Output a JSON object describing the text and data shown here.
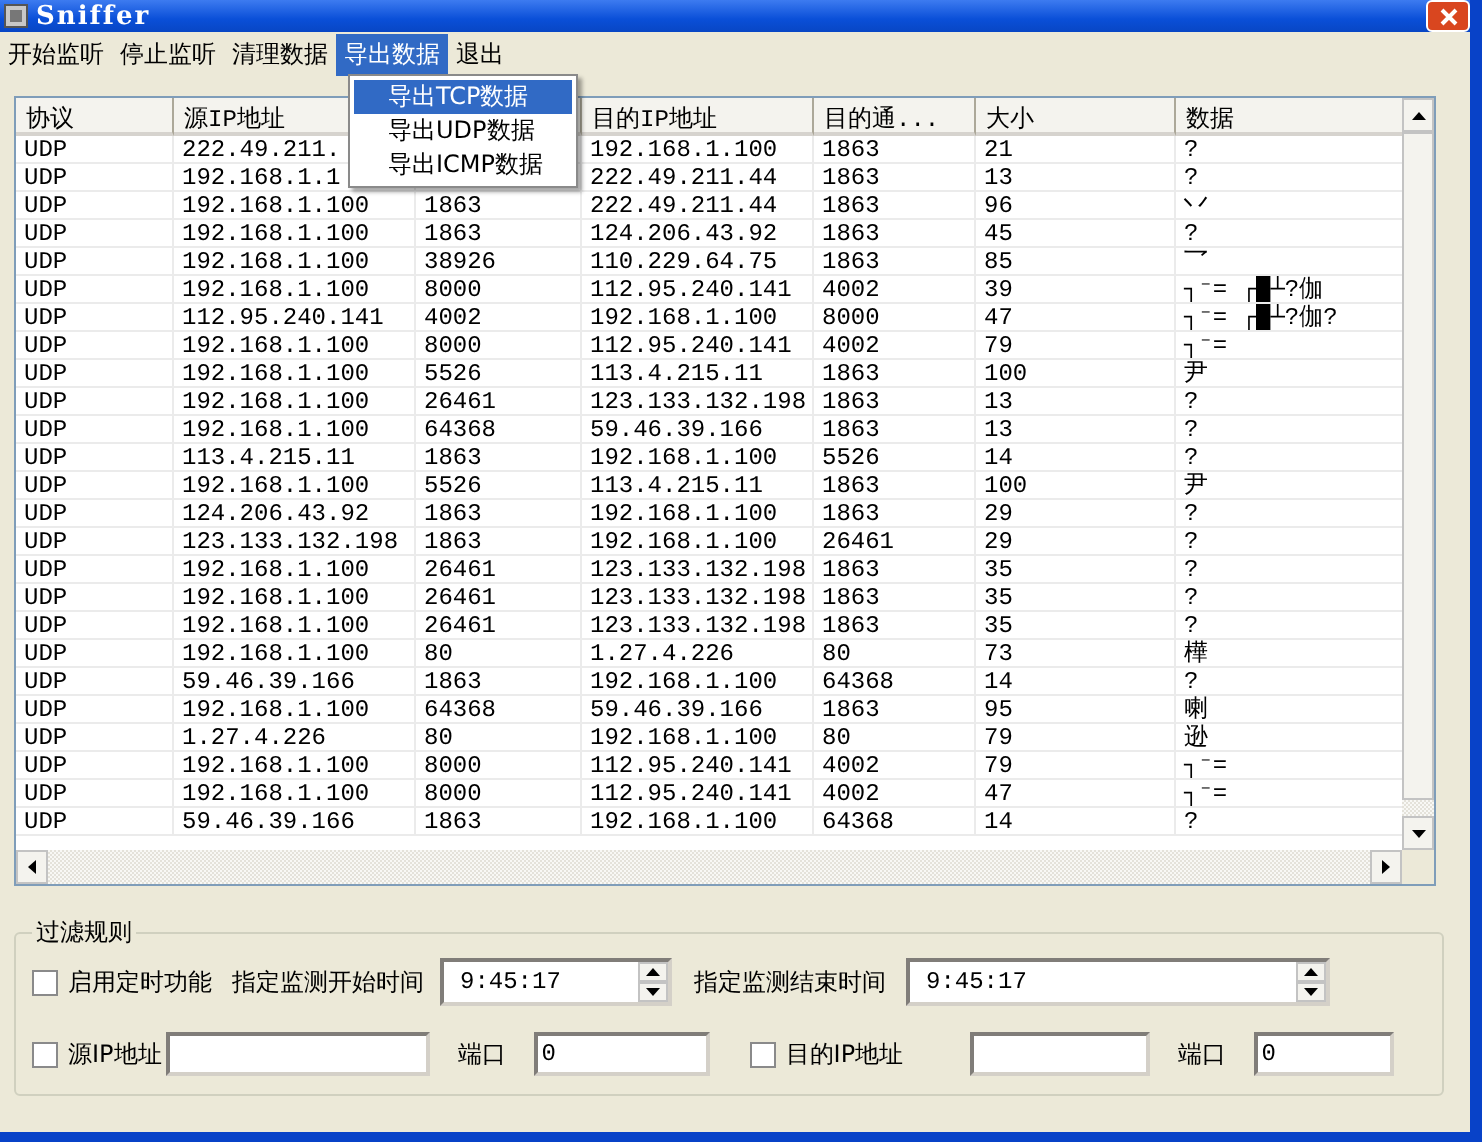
{
  "window": {
    "title": "Sniffer"
  },
  "menu": [
    {
      "label": "开始监听",
      "selected": false
    },
    {
      "label": "停止监听",
      "selected": false
    },
    {
      "label": "清理数据",
      "selected": false
    },
    {
      "label": "导出数据",
      "selected": true
    },
    {
      "label": "退出",
      "selected": false
    }
  ],
  "export_menu": [
    {
      "label": "导出TCP数据",
      "selected": true
    },
    {
      "label": "导出UDP数据",
      "selected": false
    },
    {
      "label": "导出ICMP数据",
      "selected": false
    }
  ],
  "table": {
    "columns": {
      "protocol": "协议",
      "source_ip": "源IP地址",
      "dest_ip": "目的IP地址",
      "column_5": "目的通...",
      "size": "大小",
      "data": "数据"
    },
    "rows": [
      {
        "protocol": "UDP",
        "source_ip": "222.49.211.",
        "dest_ip": "192.168.1.100",
        "column_5": "1863",
        "size": "21",
        "data": "?"
      },
      {
        "protocol": "UDP",
        "source_ip": "192.168.1.1",
        "dest_ip": "222.49.211.44",
        "column_5": "1863",
        "size": "13",
        "data": "?"
      },
      {
        "protocol": "UDP",
        "source_ip": "192.168.1.100",
        "column_3": "1863",
        "dest_ip": "222.49.211.44",
        "column_5": "1863",
        "size": "96",
        "data": "丷"
      },
      {
        "protocol": "UDP",
        "source_ip": "192.168.1.100",
        "column_3": "1863",
        "dest_ip": "124.206.43.92",
        "column_5": "1863",
        "size": "45",
        "data": "?"
      },
      {
        "protocol": "UDP",
        "source_ip": "192.168.1.100",
        "column_3": "38926",
        "dest_ip": "110.229.64.75",
        "column_5": "1863",
        "size": "85",
        "data": "乛"
      },
      {
        "protocol": "UDP",
        "source_ip": "192.168.1.100",
        "column_3": "8000",
        "dest_ip": "112.95.240.141",
        "column_5": "4002",
        "size": "39",
        "data": "┐⁻= ┌█┴?伽"
      },
      {
        "protocol": "UDP",
        "source_ip": "112.95.240.141",
        "column_3": "4002",
        "dest_ip": "192.168.1.100",
        "column_5": "8000",
        "size": "47",
        "data": "┐⁻= ┌█┴?伽?"
      },
      {
        "protocol": "UDP",
        "source_ip": "192.168.1.100",
        "column_3": "8000",
        "dest_ip": "112.95.240.141",
        "column_5": "4002",
        "size": "79",
        "data": "┐⁻="
      },
      {
        "protocol": "UDP",
        "source_ip": "192.168.1.100",
        "column_3": "5526",
        "dest_ip": "113.4.215.11",
        "column_5": "1863",
        "size": "100",
        "data": "尹"
      },
      {
        "protocol": "UDP",
        "source_ip": "192.168.1.100",
        "column_3": "26461",
        "dest_ip": "123.133.132.198",
        "column_5": "1863",
        "size": "13",
        "data": "?"
      },
      {
        "protocol": "UDP",
        "source_ip": "192.168.1.100",
        "column_3": "64368",
        "dest_ip": "59.46.39.166",
        "column_5": "1863",
        "size": "13",
        "data": "?"
      },
      {
        "protocol": "UDP",
        "source_ip": "113.4.215.11",
        "column_3": "1863",
        "dest_ip": "192.168.1.100",
        "column_5": "5526",
        "size": "14",
        "data": "?"
      },
      {
        "protocol": "UDP",
        "source_ip": "192.168.1.100",
        "column_3": "5526",
        "dest_ip": "113.4.215.11",
        "column_5": "1863",
        "size": "100",
        "data": "尹"
      },
      {
        "protocol": "UDP",
        "source_ip": "124.206.43.92",
        "column_3": "1863",
        "dest_ip": "192.168.1.100",
        "column_5": "1863",
        "size": "29",
        "data": "?"
      },
      {
        "protocol": "UDP",
        "source_ip": "123.133.132.198",
        "column_3": "1863",
        "dest_ip": "192.168.1.100",
        "column_5": "26461",
        "size": "29",
        "data": "?"
      },
      {
        "protocol": "UDP",
        "source_ip": "192.168.1.100",
        "column_3": "26461",
        "dest_ip": "123.133.132.198",
        "column_5": "1863",
        "size": "35",
        "data": "?"
      },
      {
        "protocol": "UDP",
        "source_ip": "192.168.1.100",
        "column_3": "26461",
        "dest_ip": "123.133.132.198",
        "column_5": "1863",
        "size": "35",
        "data": "?"
      },
      {
        "protocol": "UDP",
        "source_ip": "192.168.1.100",
        "column_3": "26461",
        "dest_ip": "123.133.132.198",
        "column_5": "1863",
        "size": "35",
        "data": "?"
      },
      {
        "protocol": "UDP",
        "source_ip": "192.168.1.100",
        "column_3": "80",
        "dest_ip": "1.27.4.226",
        "column_5": "80",
        "size": "73",
        "data": "樺"
      },
      {
        "protocol": "UDP",
        "source_ip": "59.46.39.166",
        "column_3": "1863",
        "dest_ip": "192.168.1.100",
        "column_5": "64368",
        "size": "14",
        "data": "?"
      },
      {
        "protocol": "UDP",
        "source_ip": "192.168.1.100",
        "column_3": "64368",
        "dest_ip": "59.46.39.166",
        "column_5": "1863",
        "size": "95",
        "data": "喇"
      },
      {
        "protocol": "UDP",
        "source_ip": "1.27.4.226",
        "column_3": "80",
        "dest_ip": "192.168.1.100",
        "column_5": "80",
        "size": "79",
        "data": "逊"
      },
      {
        "protocol": "UDP",
        "source_ip": "192.168.1.100",
        "column_3": "8000",
        "dest_ip": "112.95.240.141",
        "column_5": "4002",
        "size": "79",
        "data": "┐⁻="
      },
      {
        "protocol": "UDP",
        "source_ip": "192.168.1.100",
        "column_3": "8000",
        "dest_ip": "112.95.240.141",
        "column_5": "4002",
        "size": "47",
        "data": "┐⁻="
      },
      {
        "protocol": "UDP",
        "source_ip": "59.46.39.166",
        "column_3": "1863",
        "dest_ip": "192.168.1.100",
        "column_5": "64368",
        "size": "14",
        "data": "?"
      }
    ]
  },
  "filter": {
    "title": "过滤规则",
    "timer": {
      "label": "启用定时功能",
      "checked": false
    },
    "start_time": {
      "label": "指定监测开始时间",
      "value": "9:45:17"
    },
    "end_time": {
      "label": "指定监测结束时间",
      "value": "9:45:17"
    },
    "source_ip": {
      "label": "源IP地址",
      "checked": false
    },
    "source_port": {
      "label": "端口",
      "value": "0"
    },
    "dest_ip": {
      "label": "目的IP地址",
      "checked": false
    },
    "dest_port": {
      "label": "端口",
      "value": "0"
    }
  }
}
